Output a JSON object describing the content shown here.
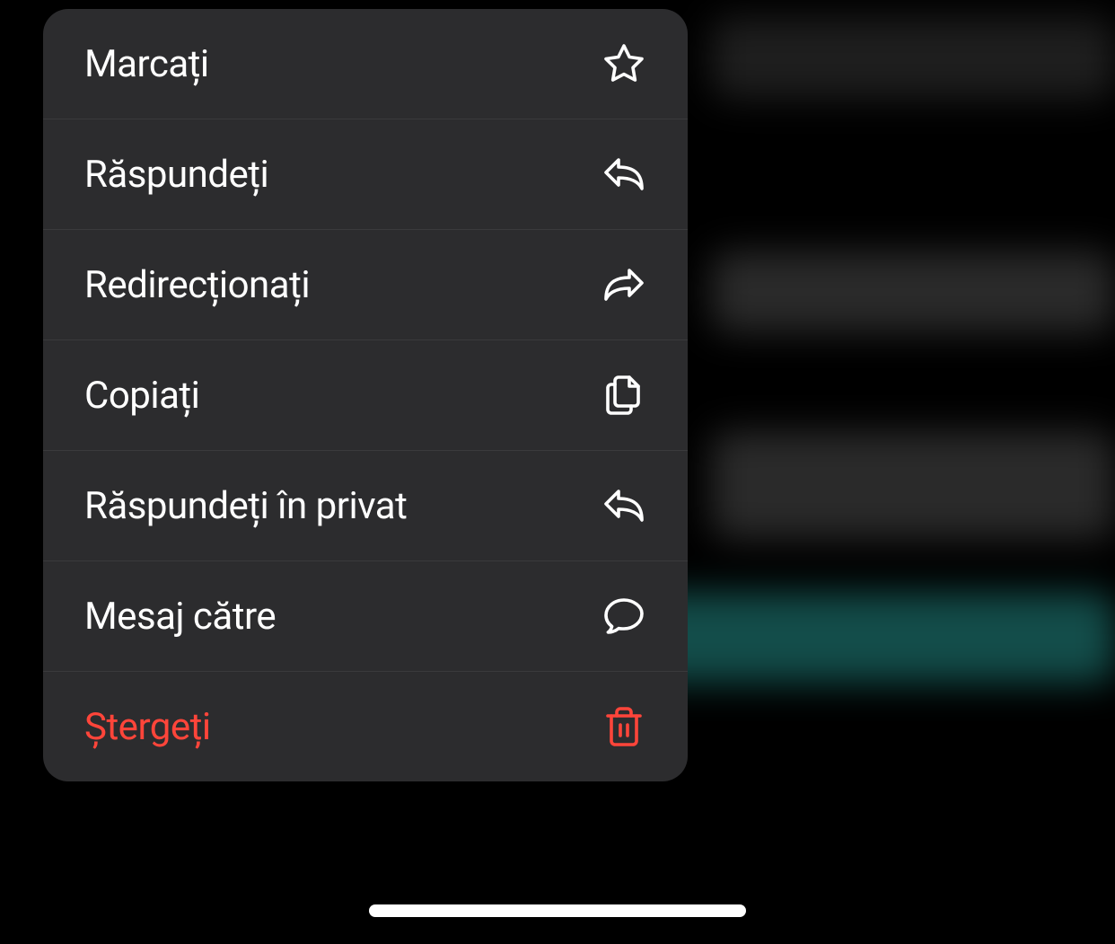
{
  "menu": {
    "items": [
      {
        "label": "Marcați",
        "icon": "star",
        "destructive": false
      },
      {
        "label": "Răspundeți",
        "icon": "reply",
        "destructive": false
      },
      {
        "label": "Redirecționați",
        "icon": "forward",
        "destructive": false
      },
      {
        "label": "Copiați",
        "icon": "copy",
        "destructive": false
      },
      {
        "label": "Răspundeți în privat",
        "icon": "reply",
        "destructive": false
      },
      {
        "label": "Mesaj către",
        "icon": "chat",
        "destructive": false
      },
      {
        "label": "Ștergeți",
        "icon": "trash",
        "destructive": true
      }
    ]
  }
}
